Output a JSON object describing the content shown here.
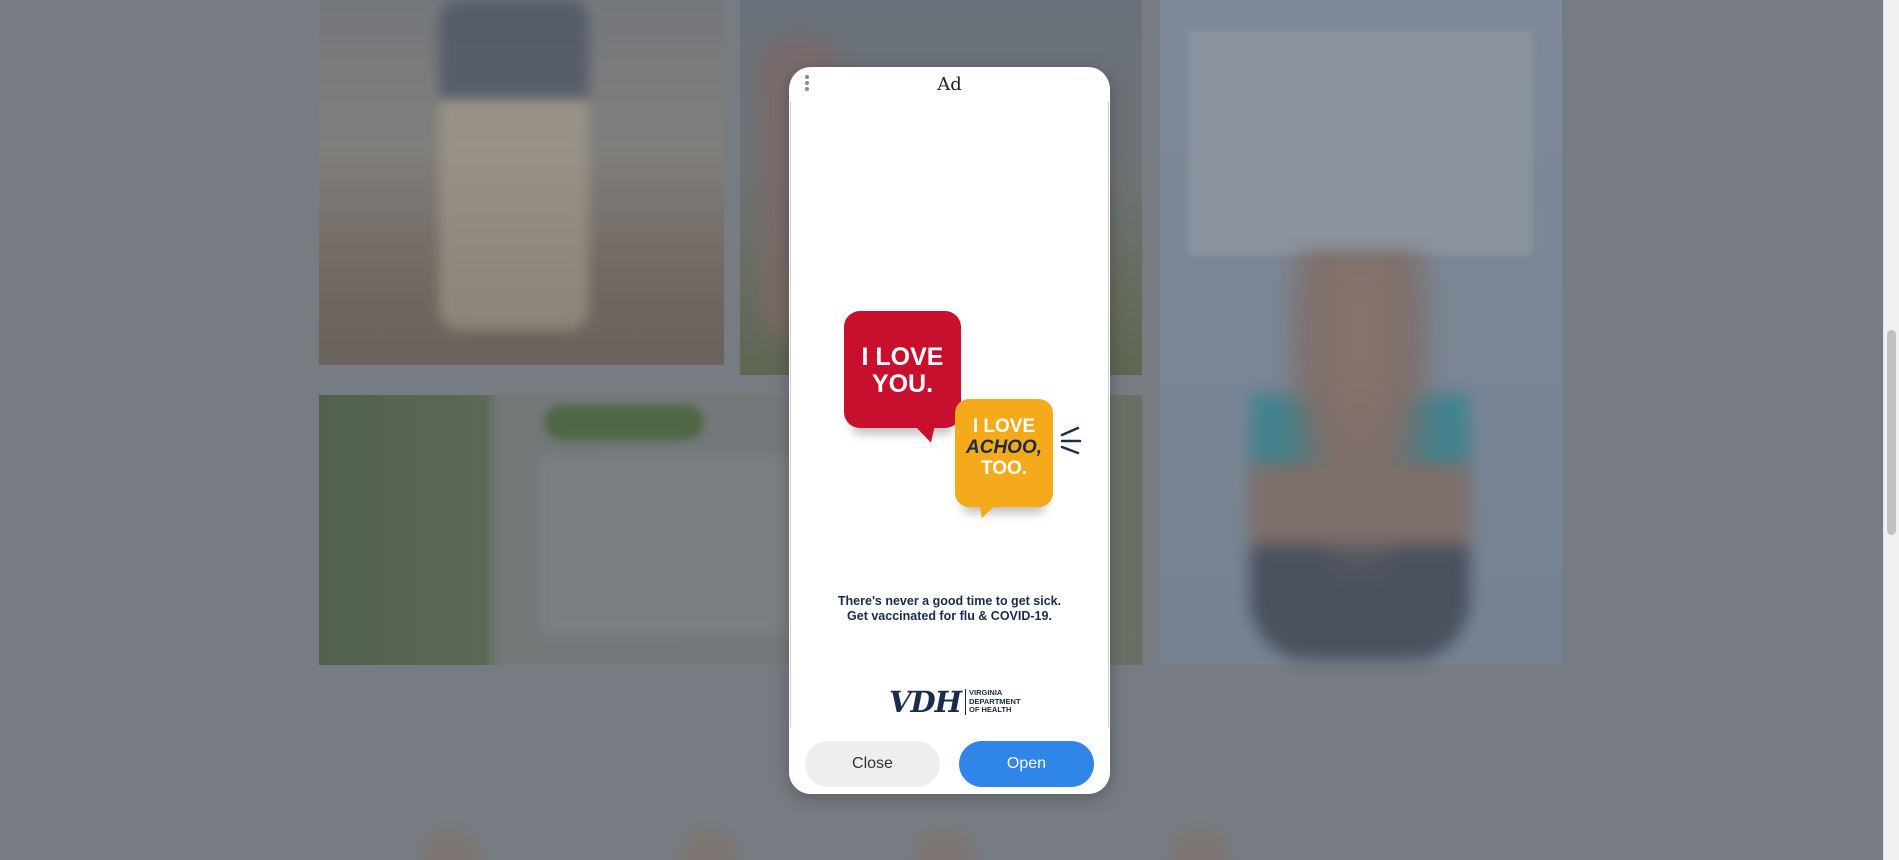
{
  "ad": {
    "label": "Ad",
    "creative": {
      "bubble_red_lines": [
        "I LOVE",
        "YOU."
      ],
      "bubble_yellow_lines": [
        "I LOVE",
        "ACHOO,",
        "TOO."
      ],
      "tagline_line1": "There's never a good time to get sick.",
      "tagline_line2": "Get vaccinated for flu & COVID-19.",
      "logo_mark": "VDH",
      "logo_name_lines": [
        "VIRGINIA",
        "DEPARTMENT",
        "OF HEALTH"
      ]
    },
    "buttons": {
      "close_label": "Close",
      "open_label": "Open"
    }
  },
  "colors": {
    "red": "#c8102e",
    "yellow": "#f5aa1c",
    "navy": "#1a2b4c",
    "open_button": "#2f86e8",
    "close_button": "#eeeeee"
  }
}
